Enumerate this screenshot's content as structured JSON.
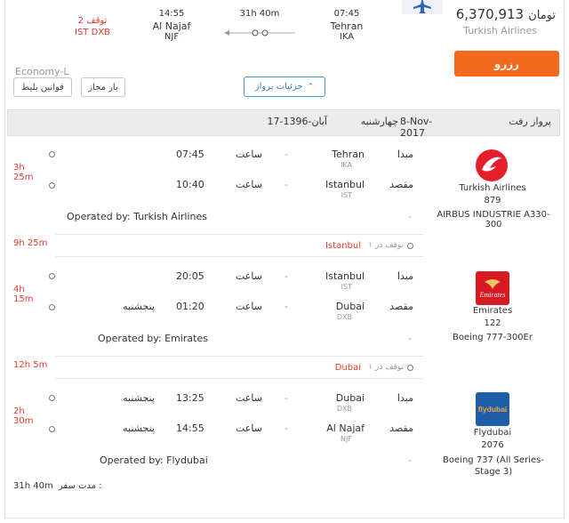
{
  "summary": {
    "price": "6,370,913",
    "currency": "تومان",
    "airline": "Turkish Airlines",
    "dep_time": "07:45",
    "dep_city": "Tehran",
    "dep_code": "IKA",
    "duration": "31h 40m",
    "arr_time": "14:55",
    "arr_city": "Al Najaf",
    "arr_code": "NJF",
    "stops": "2 توقف",
    "stop_codes": "IST DXB",
    "cabin": "Economy-L",
    "reserve_label": "رزرو",
    "details_label": "جزئیات پرواز",
    "baggage_label": "بار مجاز",
    "rules_label": "قوانین بلیط"
  },
  "flight_header": {
    "title": "پرواز رفت",
    "date_greg": "8-Nov-2017",
    "weekday": "چهارشنبه",
    "date_persian": "17-آبان-1396"
  },
  "labels": {
    "origin": "مبدا",
    "destination": "مقصد",
    "time_word": "ساعت",
    "dash": "-",
    "operated_by": "Operated by:",
    "stop_in": "۱ توقف در",
    "trip_duration": "مدت سفر :"
  },
  "segments": [
    {
      "airline": "Turkish Airlines",
      "flight_no": "879",
      "aircraft": "AIRBUS INDUSTRIE A330-300",
      "duration": "3h 25m",
      "from_city": "Tehran",
      "from_code": "IKA",
      "dep_time": "07:45",
      "dep_day": "",
      "to_city": "Istanbul",
      "to_code": "IST",
      "arr_time": "10:40",
      "arr_day": "",
      "operator": "Turkish Airlines"
    },
    {
      "airline": "Emirates",
      "flight_no": "122",
      "aircraft": "Boeing 777-300Er",
      "duration": "4h 15m",
      "from_city": "Istanbul",
      "from_code": "IST",
      "dep_time": "20:05",
      "dep_day": "",
      "to_city": "Dubai",
      "to_code": "DXB",
      "arr_time": "01:20",
      "arr_day": "پنجشنبه",
      "operator": "Emirates"
    },
    {
      "airline": "Flydubai",
      "flight_no": "2076",
      "aircraft": "Boeing 737 (All Series-Stage 3)",
      "duration": "2h 30m",
      "from_city": "Dubai",
      "from_code": "DXB",
      "dep_time": "13:25",
      "dep_day": "پنجشنبه",
      "to_city": "Al Najaf",
      "to_code": "NJF",
      "arr_time": "14:55",
      "arr_day": "پنجشنبه",
      "operator": "Flydubai"
    }
  ],
  "layovers": [
    {
      "duration": "9h 25m",
      "city": "Istanbul"
    },
    {
      "duration": "12h 5m",
      "city": "Dubai"
    }
  ],
  "total_duration": "31h 40m",
  "colors": {
    "accent": "#f26b1d",
    "red": "#e0392b",
    "blue": "#3a7cc4"
  },
  "icons": {
    "plane": "plane-icon",
    "chevron": "chevron-up-icon"
  }
}
